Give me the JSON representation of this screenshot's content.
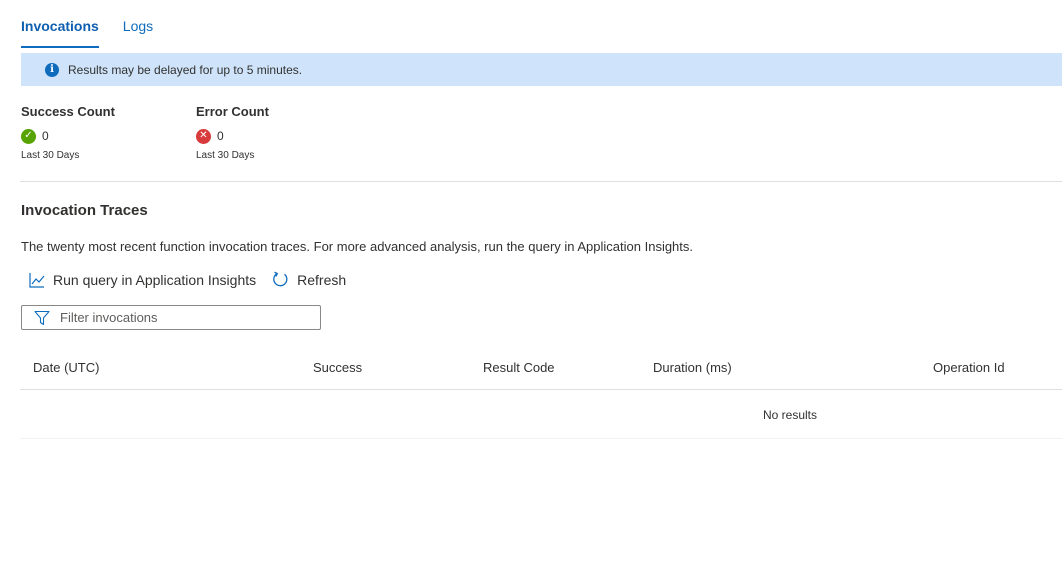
{
  "tabs": [
    {
      "label": "Invocations",
      "active": true
    },
    {
      "label": "Logs",
      "active": false
    }
  ],
  "banner": {
    "icon": "info-icon",
    "text": "Results may be delayed for up to 5 minutes."
  },
  "stats": {
    "success": {
      "title": "Success Count",
      "value": "0",
      "period": "Last 30 Days",
      "icon": "check-circle-icon",
      "color": "#57a300"
    },
    "error": {
      "title": "Error Count",
      "value": "0",
      "period": "Last 30 Days",
      "icon": "error-circle-icon",
      "color": "#d83b3b"
    }
  },
  "traces": {
    "title": "Invocation Traces",
    "description": "The twenty most recent function invocation traces. For more advanced analysis, run the query in Application Insights.",
    "toolbar": {
      "run_query_label": "Run query in Application Insights",
      "refresh_label": "Refresh"
    },
    "filter": {
      "placeholder": "Filter invocations",
      "value": ""
    },
    "table": {
      "columns": [
        "Date (UTC)",
        "Success",
        "Result Code",
        "Duration (ms)",
        "Operation Id"
      ],
      "rows": [],
      "empty_text": "No results"
    }
  },
  "colors": {
    "accent": "#0f6cbd",
    "banner_bg": "#cfe4fa"
  }
}
